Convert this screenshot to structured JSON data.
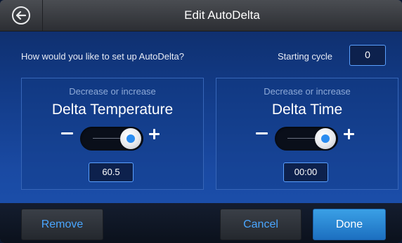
{
  "header": {
    "title": "Edit AutoDelta",
    "back_icon": "back-arrow-icon"
  },
  "setup": {
    "prompt": "How would you like to set up AutoDelta?",
    "starting_cycle_label": "Starting cycle",
    "starting_cycle_value": "0"
  },
  "panels": [
    {
      "subtitle": "Decrease or increase",
      "title": "Delta Temperature",
      "value": "60.5",
      "slider_level": 1.0
    },
    {
      "subtitle": "Decrease or increase",
      "title": "Delta Time",
      "value": "00:00",
      "slider_level": 1.0
    }
  ],
  "footer": {
    "remove_label": "Remove",
    "cancel_label": "Cancel",
    "done_label": "Done"
  },
  "colors": {
    "accent": "#4aa6ff",
    "done_button": "#2a8cf0",
    "background": "#123a85"
  }
}
